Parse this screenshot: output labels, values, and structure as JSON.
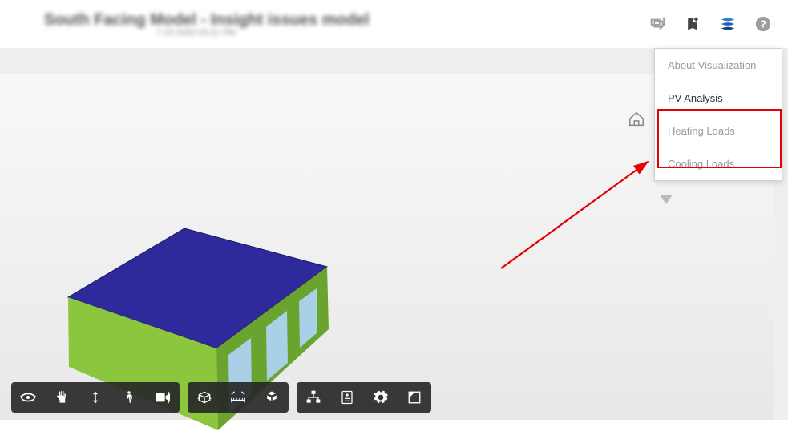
{
  "header": {
    "title": "South Facing Model - Insight issues model",
    "subtitle": "7 23 2020 03:21 PM"
  },
  "menu": {
    "items": [
      {
        "label": "About Visualization",
        "active": false
      },
      {
        "label": "PV Analysis",
        "active": true
      },
      {
        "label": "Heating Loads",
        "active": false
      },
      {
        "label": "Cooling Loads",
        "active": false
      }
    ]
  },
  "colors": {
    "roof": "#2e2a9b",
    "wall_front": "#8cc63f",
    "wall_side": "#6aa32e",
    "window": "#a8d0e6",
    "annotation": "#e60000"
  }
}
